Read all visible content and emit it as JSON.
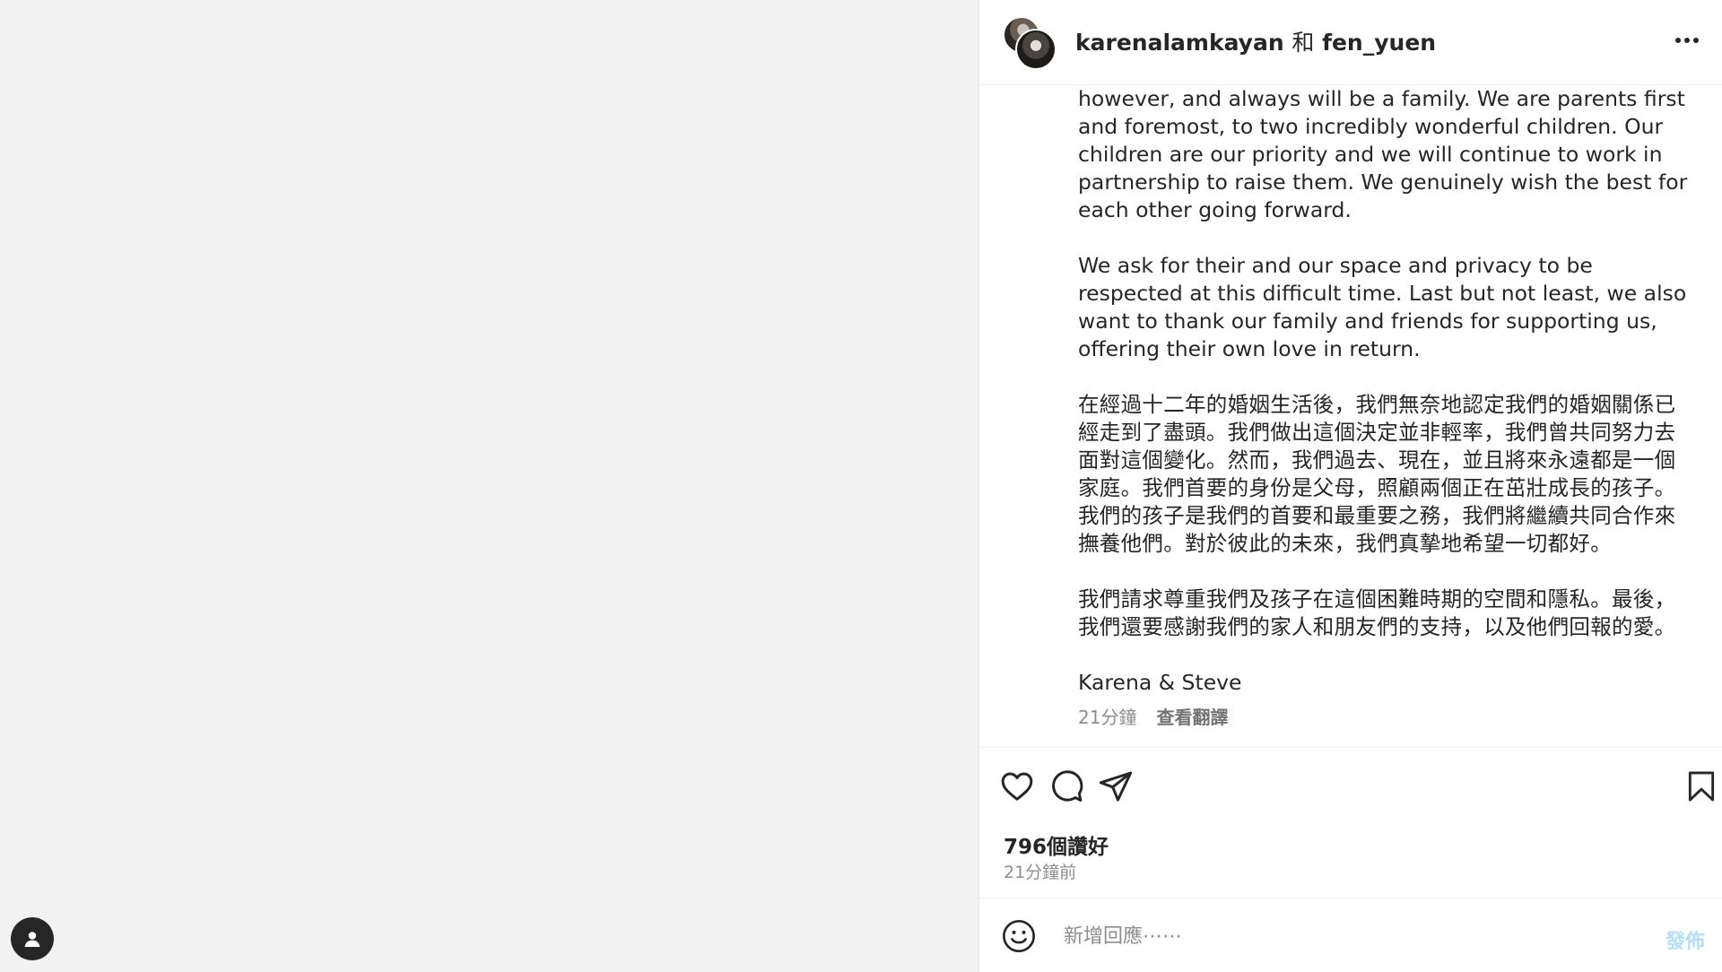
{
  "header": {
    "user1": "karenalamkayan",
    "joiner": "和",
    "user2": "fen_yuen"
  },
  "caption": {
    "para_en_1": "however, and always will be a family. We are parents first and foremost, to two incredibly wonderful children. Our children are our priority and we will continue to work in partnership to raise them. We genuinely wish the best for each other going forward.",
    "para_en_2": "We ask for their and our space and privacy to be respected at this difficult time. Last but not least, we also want to thank our family and friends for supporting us, offering their own love in return.",
    "para_zh_1": "在經過十二年的婚姻生活後，我們無奈地認定我們的婚姻關係已經走到了盡頭。我們做出這個決定並非輕率，我們曾共同努力去面對這個變化。然而，我們過去、現在，並且將來永遠都是一個家庭。我們首要的身份是父母，照顧兩個正在茁壯成長的孩子。我們的孩子是我們的首要和最重要之務，我們將繼續共同合作來撫養他們。對於彼此的未來，我們真摯地希望一切都好。",
    "para_zh_2": "我們請求尊重我們及孩子在這個困難時期的空間和隱私。最後，我們還要感謝我們的家人和朋友們的支持，以及他們回報的愛。",
    "signature": "Karena & Steve",
    "time": "21分鐘",
    "translate": "查看翻譯"
  },
  "stats": {
    "likes": "796個讚好",
    "time_ago": "21分鐘前"
  },
  "comment": {
    "placeholder": "新增回應⋯⋯",
    "post_label": "發佈"
  },
  "icons": {
    "like": "heart-icon",
    "comment": "comment-icon",
    "share": "paper-plane-icon",
    "save": "bookmark-icon",
    "more": "more-horizontal-icon",
    "emoji": "emoji-icon",
    "profile": "profile-icon"
  },
  "colors": {
    "text": "#262626",
    "muted": "#8e8e8e",
    "post_disabled": "#b2dffc",
    "background_left": "#f2f2f2"
  }
}
